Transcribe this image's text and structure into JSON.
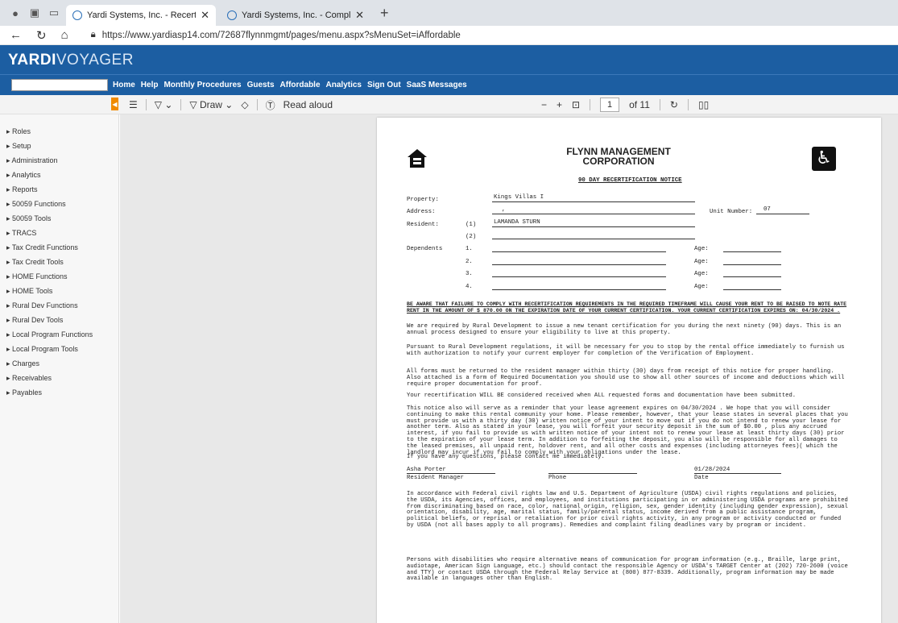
{
  "browser": {
    "tabs": [
      {
        "title": "Yardi Systems, Inc. - Recertificatio",
        "active": true
      },
      {
        "title": "Yardi Systems, Inc. - Compliance",
        "active": false
      }
    ],
    "new_tab": "+",
    "url": "https://www.yardiasp14.com/72687flynnmgmt/pages/menu.aspx?sMenuSet=iAffordable"
  },
  "app": {
    "logo_bold": "YARDI",
    "logo_light": "VOYAGER",
    "menu": [
      "Home",
      "Help",
      "Monthly Procedures",
      "Guests",
      "Affordable",
      "Analytics",
      "Sign Out",
      "SaaS Messages"
    ]
  },
  "pdf_toolbar": {
    "draw_label": "Draw",
    "read_aloud": "Read aloud",
    "minus": "−",
    "plus": "+",
    "page_current": "1",
    "page_total": "of 11"
  },
  "sidebar": [
    "Roles",
    "Setup",
    "Administration",
    "Analytics",
    "Reports",
    "50059 Functions",
    "50059 Tools",
    "TRACS",
    "Tax Credit Functions",
    "Tax Credit Tools",
    "HOME Functions",
    "HOME Tools",
    "Rural Dev Functions",
    "Rural Dev Tools",
    "Local Program Functions",
    "Local Program Tools",
    "Charges",
    "Receivables",
    "Payables"
  ],
  "document": {
    "org_line1": "FLYNN MANAGEMENT",
    "org_line2": "CORPORATION",
    "notice_title": "90 DAY RECERTIFICATION NOTICE",
    "eho_caption": "EQUAL HOUSING OPPORTUNITY",
    "ada_symbol": "♿",
    "property_label": "Property:",
    "property_value": "Kings Villas I",
    "address_label": "Address:",
    "address_value": ",",
    "unit_label": "Unit Number:",
    "unit_value": "07",
    "resident_label": "Resident:",
    "res1": "(1)",
    "res1_value": "LAMANDA STURN",
    "res2": "(2)",
    "dependents_label": "Dependents",
    "dep_nums": [
      "1.",
      "2.",
      "3.",
      "4."
    ],
    "age_label": "Age:",
    "warning": "BE AWARE THAT FAILURE TO COMPLY WITH RECERTIFICATION REQUIREMENTS IN THE REQUIRED TIMEFRAME WILL CAUSE YOUR RENT TO BE RAISED TO NOTE RATE RENT IN THE AMOUNT OF $ 870.00 ON THE EXPIRATION DATE OF YOUR CURRENT CERTIFICATION. YOUR CURRENT CERTIFICATION EXPIRES ON: 04/30/2024 .",
    "p1": "We are required by Rural Development to issue a new tenant certification for you during the next ninety (90) days. This is an annual process designed to ensure your eligibility to live at this property.",
    "p2": "Pursuant to Rural Development regulations, it will be necessary for you to stop by the rental office immediately to furnish us with authorization to notify your current employer for completion of the Verification of Employment.",
    "p3": "All forms must be returned to the resident manager within thirty (30) days from receipt of this notice for proper handling. Also attached is a form of Required Documentation you should use to show all other sources of income and deductions which will require proper documentation for proof.",
    "p4": "Your recertification WILL BE considered received when ALL requested forms and documentation have been submitted.",
    "p5": "This notice also will serve as a reminder that your lease agreement expires on 04/30/2024 . We hope that you will consider continuing to make this rental community your home. Please remember, however, that your lease states in several places that you must provide us with a thirty day (30) written notice of your intent to move out if you do not intend to renew your lease for another term. Also as stated in your lease, you will forfeit your security deposit in the sum of $0.00 , plus any accrued interest, if you fail to provide us with written notice of your intent not to renew your lease at least thirty days (30) prior to the expiration of your lease term. In addition to forfeiting the deposit, you also will be responsible for all damages to the leased premises, all unpaid rent, holdover rent, and all other costs and expenses (including attorneyes fees)( which the landlord may incur if you fail to comply with your obligations under the lease.",
    "p6": "If you have any questions, please contact me immediately.",
    "manager_name": "Asha Porter",
    "manager_label": "Resident Manager",
    "phone_label": "Phone",
    "date_value": "01/28/2024",
    "date_label": "Date",
    "p7": "In accordance with Federal civil rights law and U.S. Department of Agriculture (USDA) civil rights regulations and policies, the USDA, its Agencies, offices, and employees, and institutions participating in or administering USDA programs are prohibited from discriminating based on race, color, national origin, religion, sex, gender identity (including gender expression), sexual orientation, disability, age, marital status, family/parental status, income derived from a public assistance program, political beliefs, or reprisal or retaliation for prior civil rights activity, in any program or activity conducted or funded by USDA (not all bases apply to all programs). Remedies and complaint filing deadlines vary by program or incident.",
    "p8": "Persons with disabilities who require alternative means of communication for program information (e.g., Braille, large print, audiotape, American Sign Language, etc.) should contact the responsible Agency or USDA's TARGET Center at (202) 720-2600 (voice and TTY) or contact USDA through the Federal Relay Service at (800) 877-8339. Additionally, program information may be made available in languages other than English."
  }
}
